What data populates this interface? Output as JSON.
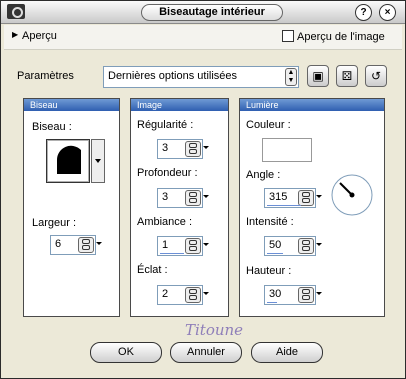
{
  "window": {
    "title": "Biseautage intérieur",
    "help_button": "?",
    "close_button": "×"
  },
  "preview": {
    "label": "Aperçu",
    "checkbox_label": "Aperçu de l'image"
  },
  "presets": {
    "label": "Paramètres",
    "value": "Dernières options utilisées"
  },
  "bevel_panel": {
    "title": "Biseau",
    "bevel_label": "Biseau :",
    "width_label": "Largeur :",
    "width_value": "6"
  },
  "image_panel": {
    "title": "Image",
    "smoothness_label": "Régularité :",
    "smoothness_value": "3",
    "depth_label": "Profondeur :",
    "depth_value": "3",
    "ambience_label": "Ambiance :",
    "ambience_value": "1",
    "shininess_label": "Éclat :",
    "shininess_value": "2"
  },
  "light_panel": {
    "title": "Lumière",
    "color_label": "Couleur :",
    "angle_label": "Angle :",
    "angle_value": "315",
    "intensity_label": "Intensité :",
    "intensity_value": "50",
    "elevation_label": "Hauteur :",
    "elevation_value": "30"
  },
  "watermark": "Titoune",
  "buttons": {
    "ok": "OK",
    "cancel": "Annuler",
    "help": "Aide"
  },
  "colors": {
    "panel_header": "#2f5fb0",
    "dialog_bg": "#ece9d8",
    "accent_underline": "#6b8fd6"
  }
}
